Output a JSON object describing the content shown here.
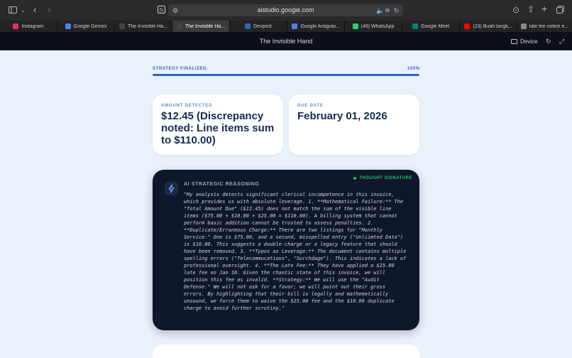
{
  "browser": {
    "url": "aistudio.google.com",
    "tabs": [
      {
        "label": "Instagram",
        "color": "#e1306c",
        "active": false
      },
      {
        "label": "Google Gemini",
        "color": "#4285f4",
        "active": false
      },
      {
        "label": "The Invisible Ha...",
        "color": "#444444",
        "active": false
      },
      {
        "label": "The Invisible Ha...",
        "color": "#444444",
        "active": true
      },
      {
        "label": "Devpost",
        "color": "#2b6cb0",
        "active": false
      },
      {
        "label": "Google Antigrav...",
        "color": "#4f7ff0",
        "active": false
      },
      {
        "label": "(49) WhatsApp",
        "color": "#25d366",
        "active": false
      },
      {
        "label": "Google Meet",
        "color": "#00897b",
        "active": false
      },
      {
        "label": "(23) Buah langk...",
        "color": "#ff0000",
        "active": false
      },
      {
        "label": "late fee notice e...",
        "color": "#8a8a8a",
        "active": false
      }
    ]
  },
  "app": {
    "title": "The Invisible Hand",
    "device_label": "Device"
  },
  "progress": {
    "label": "STRATEGY FINALIZED.",
    "percent_text": "100%",
    "percent": 100,
    "color": "#2f63c8"
  },
  "amount": {
    "label": "AMOUNT DETECTED",
    "value": "$12.45 (Discrepancy noted: Line items sum to $110.00)"
  },
  "due": {
    "label": "DUE DATE",
    "value": "February 01, 2026"
  },
  "reasoning": {
    "title": "AI STRATEGIC REASONING",
    "signature": "THOUGHT SIGNATURE",
    "signature_color": "#22c55e",
    "text": "\"My analysis detects significant clerical incompetence in this invoice, which provides us with absolute leverage. 1. **Mathematical Failure:** The \"Total Amount Due\" ($12.45) does not match the sum of the visible line items ($75.00 + $10.00 + $25.00 = $110.00). A billing system that cannot perform basic addition cannot be trusted to assess penalties. 2. **Duplicate/Erroneous Charge:** There are two listings for \"Monthly Service.\" One is $75.00, and a second, misspelled entry (\"Unliimted Data\") is $10.00. This suggests a double-charge or a legacy feature that should have been removed. 3. **Typos as Leverage:** The document contains multiple spelling errors (\"Telecommucations\", \"Surchdage\"). This indicates a lack of professional oversight. 4. **The Late Fee:** They have applied a $25.00 late fee on Jan 10. Given the chaotic state of this invoice, we will position this fee as invalid. **Strategy:** We will use the \"Audit Defense.\" We will not ask for a favor; we will point out their gross errors. By highlighting that their bill is legally and mathematically unsound, we force them to waive the $25.00 fee and the $10.00 duplicate charge to avoid further scrutiny.\""
  }
}
